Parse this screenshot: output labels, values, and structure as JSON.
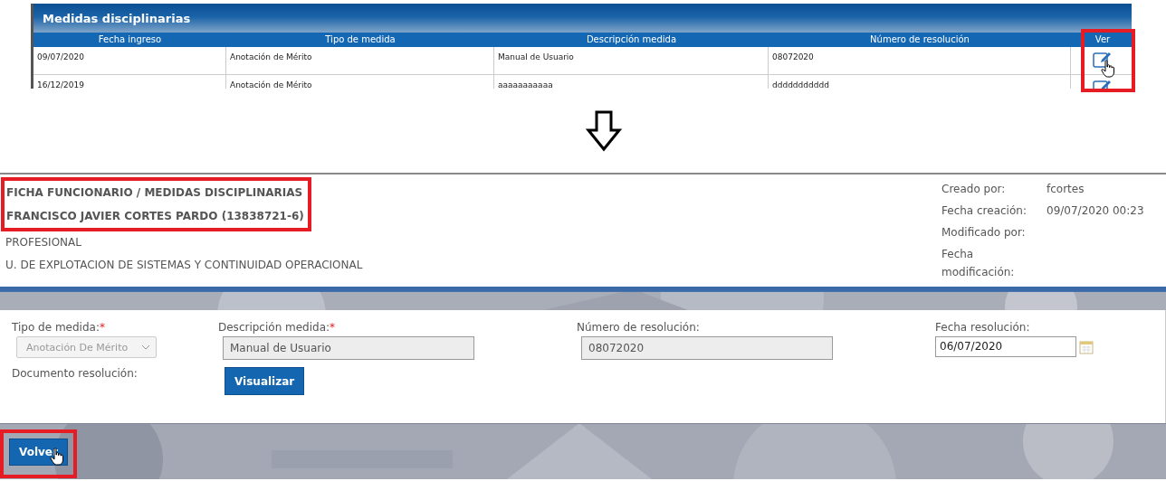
{
  "panel": {
    "title": "Medidas disciplinarias",
    "columns": [
      "Fecha ingreso",
      "Tipo de medida",
      "Descripción medida",
      "Número de resolución",
      "Ver"
    ],
    "rows": [
      {
        "cells": [
          "09/07/2020",
          "Anotación de Mérito",
          "Manual de Usuario",
          "08072020"
        ]
      },
      {
        "cells": [
          "16/12/2019",
          "Anotación de Mérito",
          "aaaaaaaaaaa",
          "ddddddddddd"
        ]
      }
    ]
  },
  "record": {
    "breadcrumb": "FICHA FUNCIONARIO / MEDIDAS DISCIPLINARIAS",
    "employee": "FRANCISCO JAVIER CORTES PARDO (13838721-6)",
    "position": "PROFESIONAL",
    "unit": "U. DE EXPLOTACION DE SISTEMAS Y CONTINUIDAD OPERACIONAL",
    "meta": [
      {
        "label": "Creado por:",
        "value": "fcortes"
      },
      {
        "label": "Fecha creación:",
        "value": "09/07/2020 00:23"
      },
      {
        "label": "Modificado por:"
      },
      {
        "label": "Fecha modificación:"
      }
    ]
  },
  "form": {
    "fields": [
      {
        "kind": "select",
        "label": "Tipo de medida:",
        "required_mark": "*",
        "value": "Anotación De Mérito",
        "disabled": true
      },
      {
        "kind": "text",
        "label": "Descripción medida:",
        "required_mark": "*",
        "value": "Manual de Usuario",
        "disabled": true
      },
      {
        "kind": "text",
        "label": "Número de resolución:",
        "value": "08072020",
        "disabled": true
      },
      {
        "kind": "date",
        "label": "Fecha resolución:",
        "value": "06/07/2020",
        "disabled": false
      }
    ],
    "document_label": "Documento resolución:",
    "view_button": "Visualizar"
  },
  "back_button": "Volver"
}
